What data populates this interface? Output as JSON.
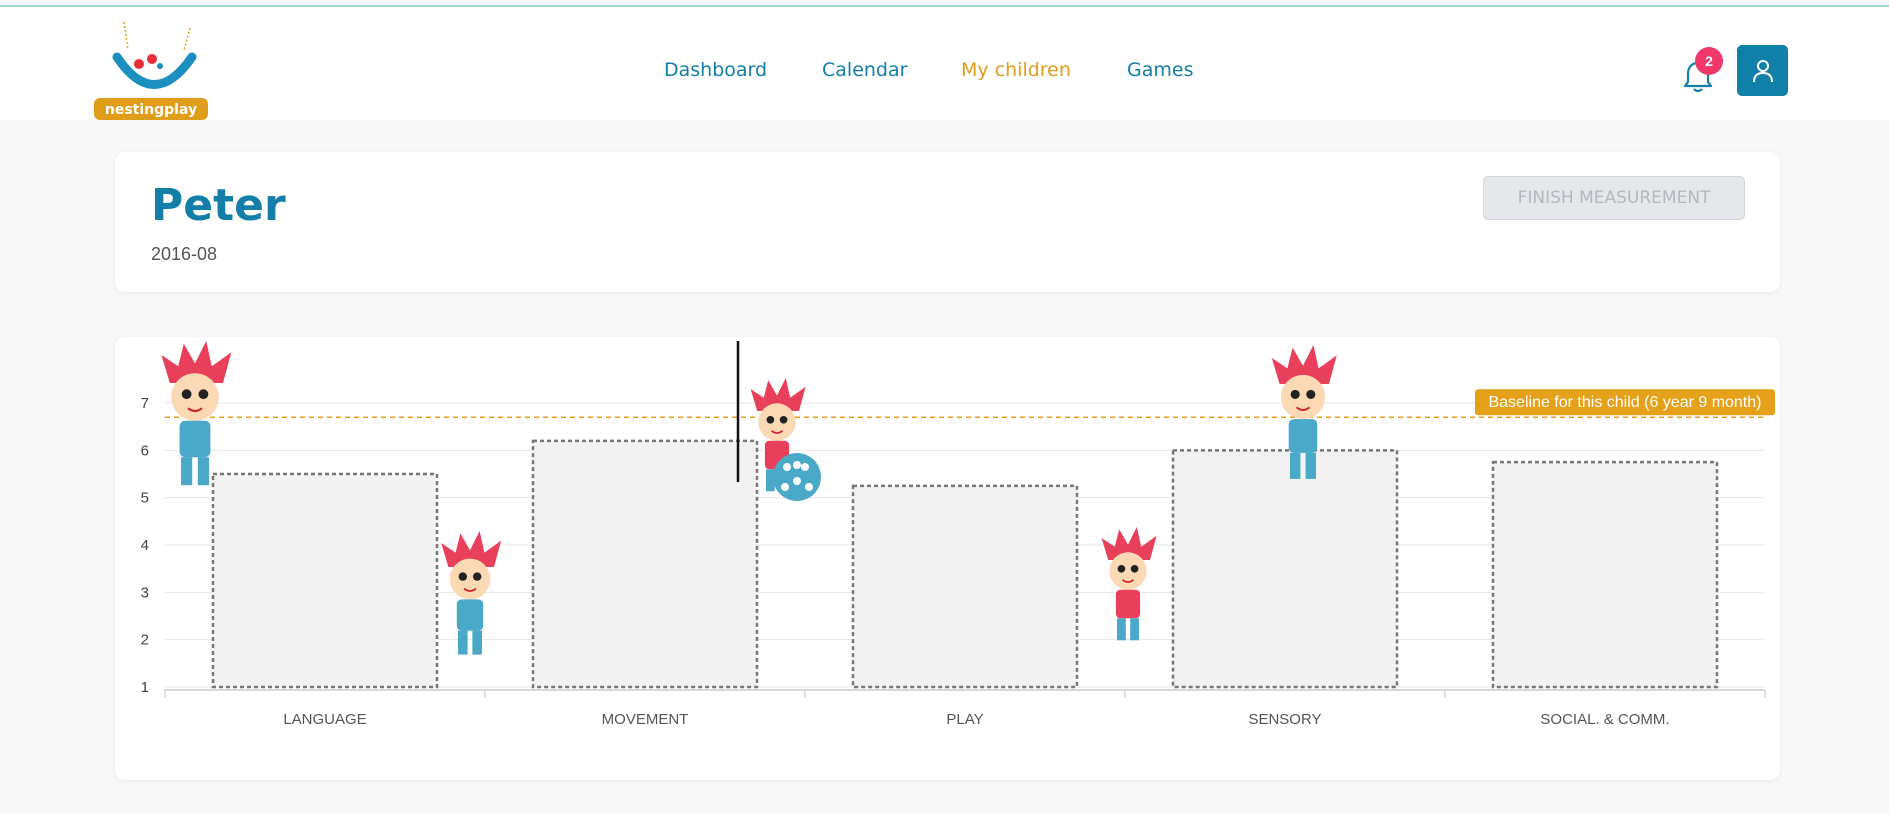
{
  "nav": {
    "links": [
      "Dashboard",
      "Calendar",
      "My children",
      "Games"
    ],
    "active_index": 2,
    "notification_count": "2"
  },
  "logo": {
    "text": "nestingplay"
  },
  "child": {
    "name": "Peter",
    "date": "2016-08"
  },
  "actions": {
    "finish_label": "FINISH MEASUREMENT"
  },
  "colors": {
    "brand_blue": "#137fa8",
    "accent_orange": "#e09d1a",
    "badge_pink": "#f0386b",
    "baseline": "#e6a11a"
  },
  "icons": [
    "bell-icon",
    "user-icon"
  ],
  "chart_data": {
    "type": "bar",
    "categories": [
      "LANGUAGE",
      "MOVEMENT",
      "PLAY",
      "SENSORY",
      "SOCIAL. & COMM."
    ],
    "values": [
      5.5,
      6.2,
      5.25,
      6.0,
      5.75
    ],
    "ylim": [
      1,
      7
    ],
    "yticks": [
      1,
      2,
      3,
      4,
      5,
      6,
      7
    ],
    "baseline": {
      "value": 6.7,
      "label": "Baseline for this child (6 year 9 month)"
    },
    "grid": true,
    "bar_style": "dashed-outline"
  }
}
